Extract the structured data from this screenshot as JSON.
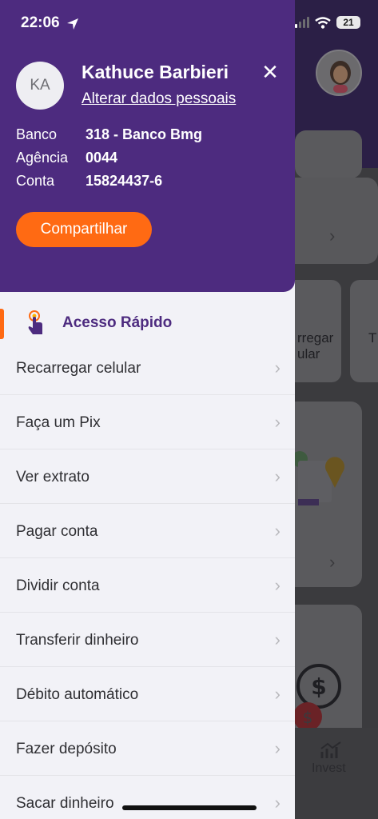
{
  "status_bar": {
    "time": "22:06",
    "battery": "21"
  },
  "profile": {
    "initials": "KA",
    "name": "Kathuce Barbieri",
    "edit_link": "Alterar dados pessoais"
  },
  "account": {
    "rows": [
      {
        "label": "Banco",
        "value": "318 - Banco Bmg"
      },
      {
        "label": "Agência",
        "value": "0044"
      },
      {
        "label": "Conta",
        "value": "15824437-6"
      }
    ]
  },
  "share_button": "Compartilhar",
  "quick_access": {
    "title": "Acesso Rápido",
    "items": [
      {
        "label": "Recarregar celular"
      },
      {
        "label": "Faça um Pix"
      },
      {
        "label": "Ver extrato"
      },
      {
        "label": "Pagar conta"
      },
      {
        "label": "Dividir conta"
      },
      {
        "label": "Transferir dinheiro"
      },
      {
        "label": "Débito automático"
      },
      {
        "label": "Fazer depósito"
      },
      {
        "label": "Sacar dinheiro"
      }
    ]
  },
  "background": {
    "card_text_1": "rregar",
    "card_text_2": "ular",
    "card_text_3": "T",
    "nav_invest": "Invest"
  },
  "colors": {
    "brand_purple": "#4d2b7f",
    "accent_orange": "#ff6a13"
  }
}
